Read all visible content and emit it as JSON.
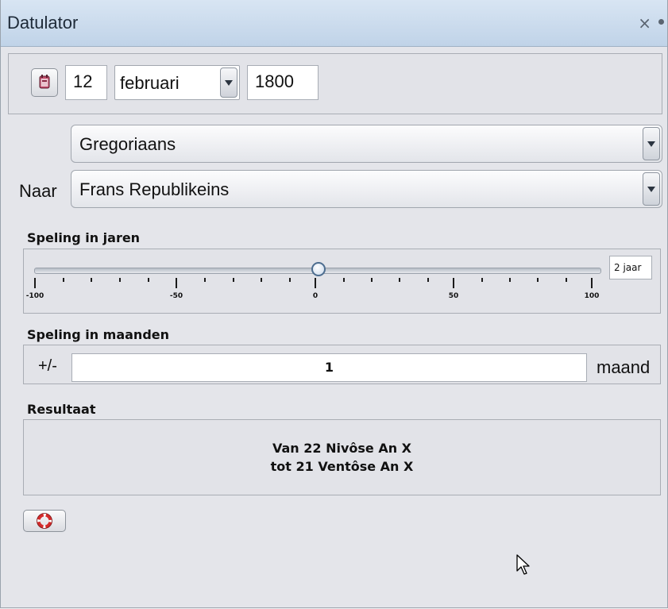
{
  "window": {
    "title": "Datulator"
  },
  "date": {
    "day": "12",
    "month": "februari",
    "year": "1800"
  },
  "calendars": {
    "from": "Gregoriaans",
    "to_label": "Naar",
    "to": "Frans Republikeins"
  },
  "years_slack": {
    "label": "Speling in jaren",
    "value_display": "2 jaar",
    "slider_value": 0,
    "min": -100,
    "max": 100,
    "tick_labels": [
      "-100",
      "-50",
      "0",
      "50",
      "100"
    ]
  },
  "months_slack": {
    "label": "Speling in maanden",
    "prefix": "+/-",
    "value": "1",
    "unit": "maand"
  },
  "result": {
    "label": "Resultaat",
    "line1": "Van 22 Nivôse An X",
    "line2": "tot 21 Ventôse An X"
  },
  "icons": {
    "calendar": "calendar-icon",
    "lifebuoy": "lifebuoy-icon",
    "close": "close-icon"
  }
}
